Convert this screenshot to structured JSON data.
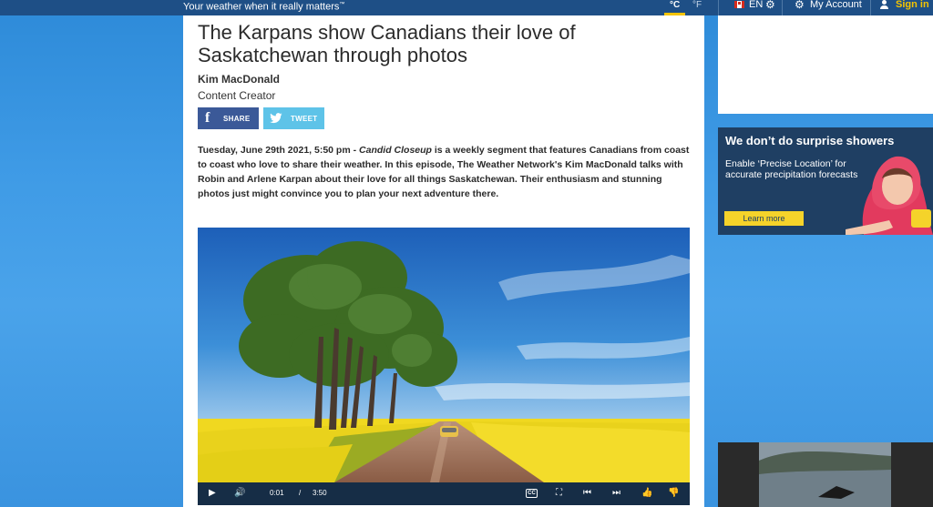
{
  "header": {
    "tagline": "Your weather when it really matters",
    "tagline_mark": "™",
    "unit_celsius": "°C",
    "unit_fahrenheit": "°F",
    "language": "EN",
    "account_label": "My Account",
    "signin_label": "Sign in"
  },
  "article": {
    "title": "The Karpans show Canadians their love of Saskatchewan through photos",
    "author": "Kim MacDonald",
    "role": "Content Creator",
    "share_label": "SHARE",
    "tweet_label": "TWEET",
    "dateline": "Tuesday, June 29th 2021, 5:50 pm -",
    "segment": "Candid Closeup",
    "body": " is a weekly segment that features Canadians from coast to coast who love to share their weather. In this episode, The Weather Network's Kim MacDonald talks with Robin and Arlene Karpan about their love for all things Saskatchewan. Their enthusiasm and stunning photos just might convince you to plan your next adventure there."
  },
  "video": {
    "current_time": "0:01",
    "separator": "/",
    "duration": "3:50",
    "cc_label": "CC",
    "progress": 0.004
  },
  "ad": {
    "headline": "We don’t do surprise showers",
    "subtext": "Enable ‘Precise Location’ for accurate precipitation forecasts",
    "cta": "Learn more"
  },
  "colors": {
    "topbar": "#1e4f86",
    "accent_yellow": "#f5c400",
    "facebook": "#3b5998",
    "twitter": "#5ec3e8",
    "ad_bg": "#1f3f63"
  }
}
